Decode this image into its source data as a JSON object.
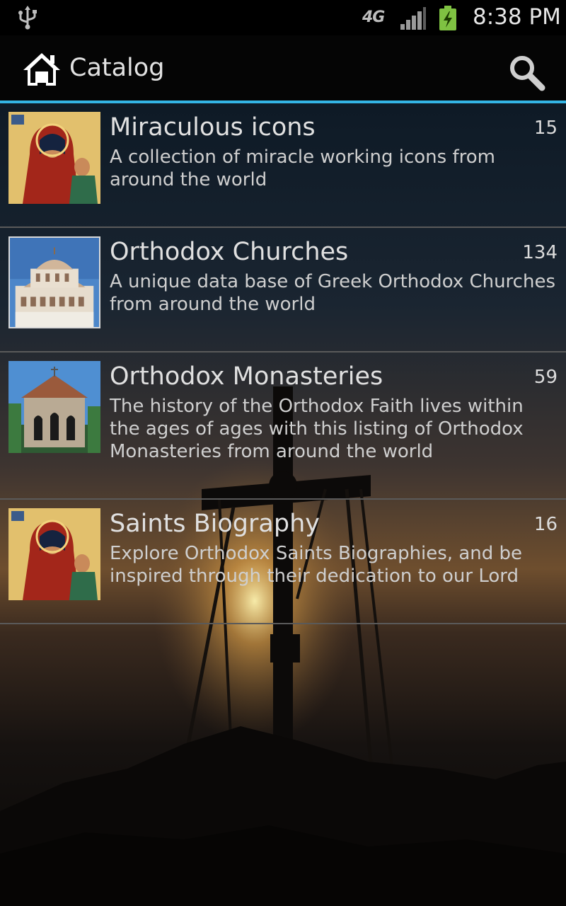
{
  "status_bar": {
    "time": "8:38 PM",
    "network": "4G",
    "icons": [
      "usb-icon",
      "network-4g-icon",
      "signal-icon",
      "battery-charging-icon"
    ]
  },
  "action_bar": {
    "title": "Catalog",
    "icons": [
      "home-icon",
      "search-icon"
    ],
    "accent_color": "#33b5e5"
  },
  "catalog": {
    "items": [
      {
        "title": "Miraculous icons",
        "count": "15",
        "description": "A collection of miracle working icons from around the world",
        "thumbnail": "madonna-icon-image"
      },
      {
        "title": "Orthodox Churches",
        "count": "134",
        "description": "A unique data base of Greek Orthodox Churches from around the world",
        "thumbnail": "church-dome-image"
      },
      {
        "title": "Orthodox Monasteries",
        "count": "59",
        "description": "The history of the Orthodox Faith lives within the ages of ages with this listing of Orthodox Monasteries from around the world",
        "thumbnail": "monastery-image"
      },
      {
        "title": "Saints Biography",
        "count": "16",
        "description": "Explore Orthodox Saints Biographies, and be inspired through their dedication to our Lord",
        "thumbnail": "madonna-icon-image"
      }
    ]
  },
  "background": "sunset-cross-silhouette"
}
